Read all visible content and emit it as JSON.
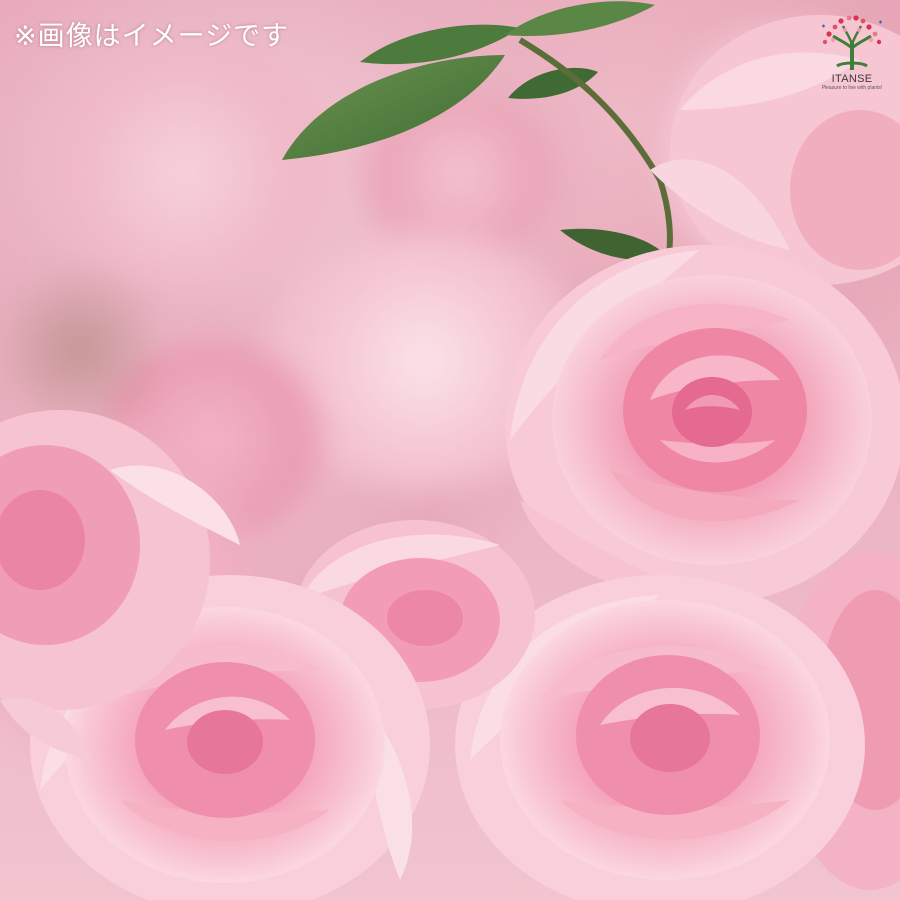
{
  "notice_text": "※画像はイメージです",
  "logo": {
    "name": "ITANSE",
    "tagline": "Pleasure to live with plants!",
    "icon": "tree-heart-logo-icon"
  },
  "colors": {
    "rose_pink": "#f08fab",
    "rose_light": "#f8cdd9",
    "rose_deep": "#e56f92",
    "leaf_green": "#4f7a3e",
    "logo_tree": "#3f7f3a",
    "logo_dots": "#d8344f"
  }
}
